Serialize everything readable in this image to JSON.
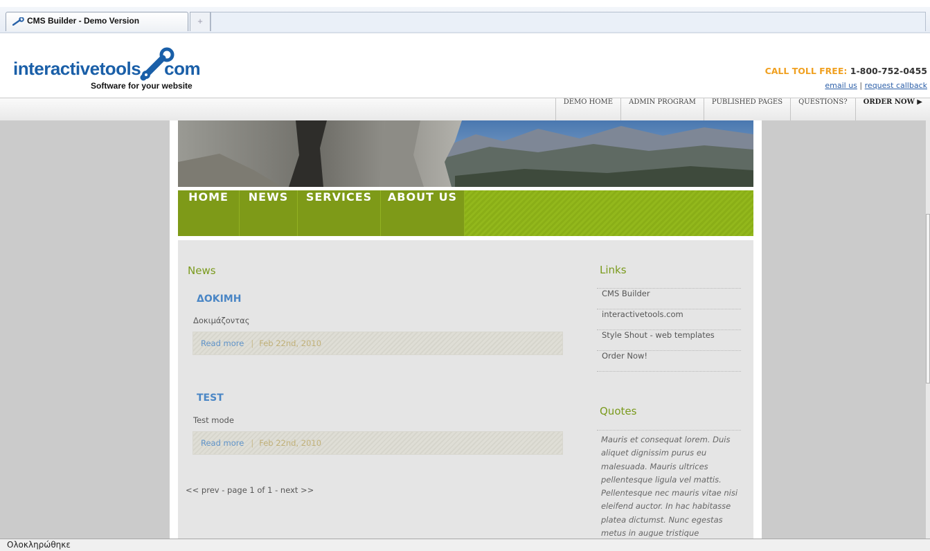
{
  "browser": {
    "tab_title": "CMS Builder - Demo Version",
    "new_tab_glyph": "+",
    "status_text": "Ολοκληρώθηκε"
  },
  "site_header": {
    "logo_main": "interactivetools",
    "logo_suffix": "com",
    "tagline": "Software for your website",
    "toll_label": "CALL TOLL FREE:",
    "toll_number": "1-800-752-0455",
    "email_link": "email us",
    "link_separator": "|",
    "callback_link": "request callback"
  },
  "top_nav": {
    "items": [
      "DEMO HOME",
      "ADMIN PROGRAM",
      "PUBLISHED PAGES",
      "QUESTIONS?",
      "ORDER NOW ▶"
    ]
  },
  "main_nav": {
    "items": [
      "HOME",
      "NEWS",
      "SERVICES",
      "ABOUT US"
    ]
  },
  "news": {
    "heading": "News",
    "posts": [
      {
        "title": "ΔΟΚΙΜΗ",
        "summary": "Δοκιμάζοντας",
        "read_more": "Read more",
        "separator": "|",
        "date": "Feb 22nd, 2010"
      },
      {
        "title": "TEST",
        "summary": "Test mode",
        "read_more": "Read more",
        "separator": "|",
        "date": "Feb 22nd, 2010"
      }
    ],
    "pager": "<< prev - page 1 of 1 - next >>"
  },
  "sidebar": {
    "links_heading": "Links",
    "links": [
      "CMS Builder",
      "interactivetools.com",
      "Style Shout - web templates",
      "Order Now!"
    ],
    "quotes_heading": "Quotes",
    "quote": "Mauris et consequat lorem. Duis aliquet dignissim purus eu malesuada. Mauris ultrices pellentesque ligula vel mattis. Pellentesque nec mauris vitae nisi eleifend auctor. In hac habitasse platea dictumst. Nunc egestas metus in augue tristique"
  },
  "colors": {
    "accent_green": "#7e9a18",
    "link_blue": "#4a86c5",
    "toll_orange": "#f0a020"
  }
}
